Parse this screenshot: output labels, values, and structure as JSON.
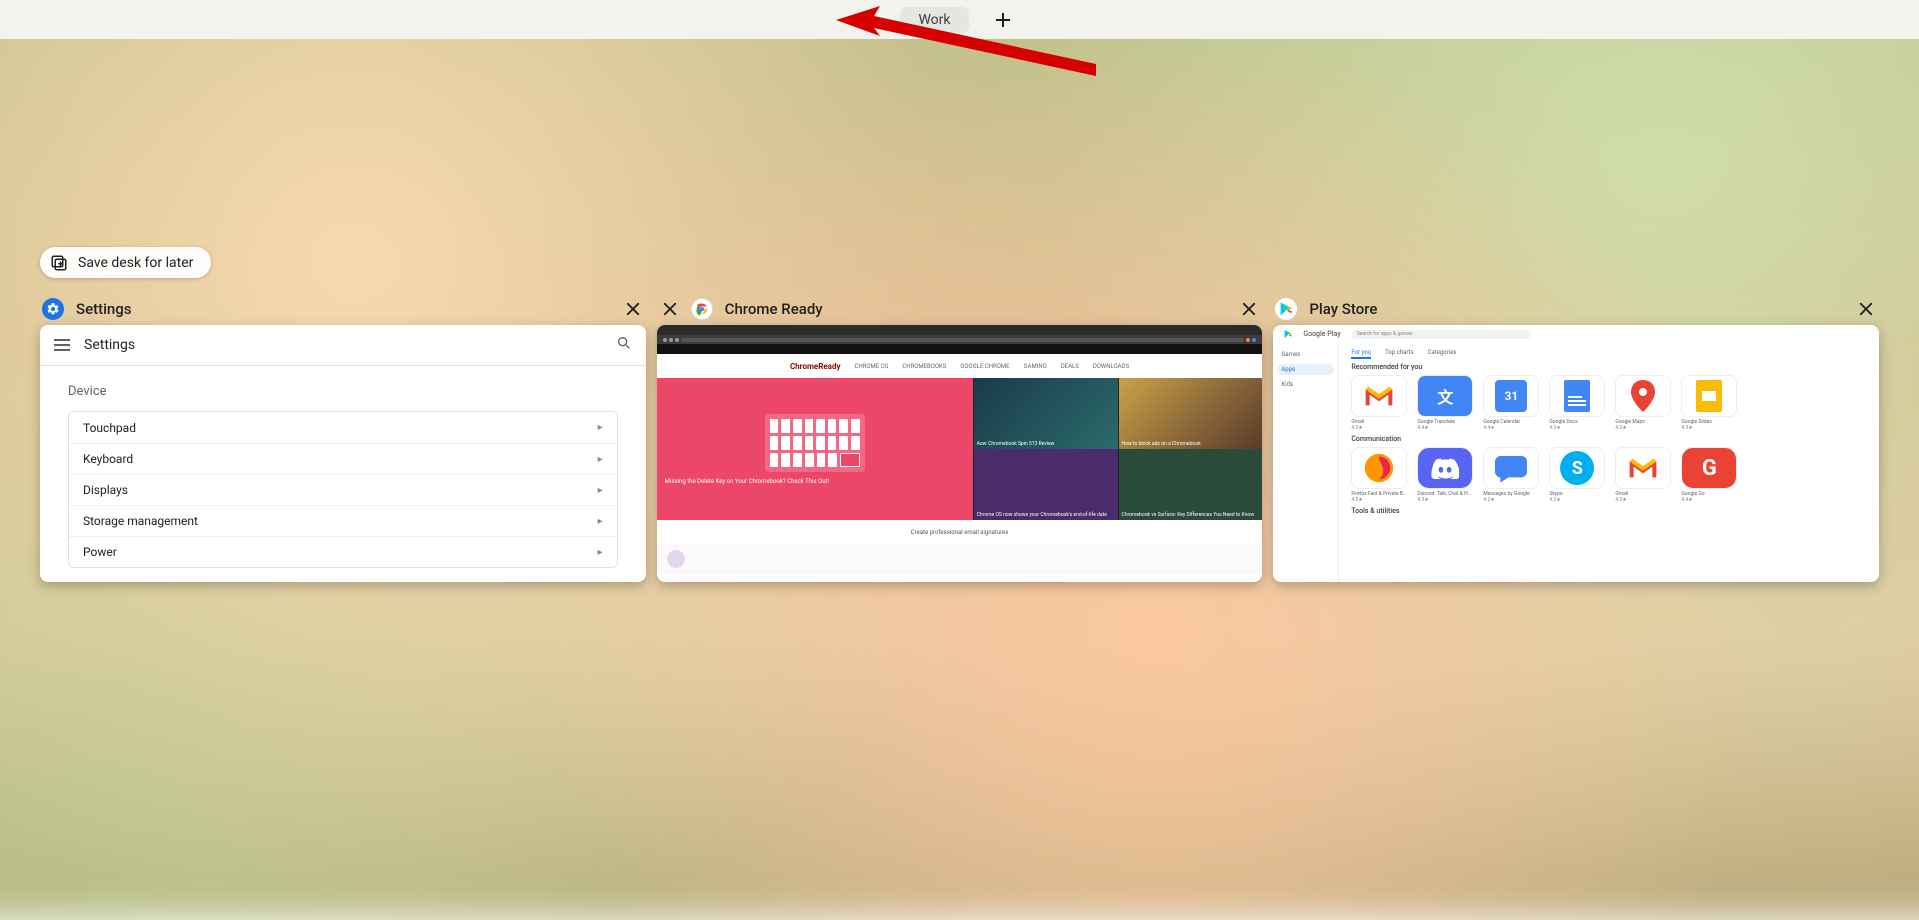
{
  "desk_bar": {
    "active_desk": "Work"
  },
  "save_pill": "Save desk for later",
  "windows": [
    {
      "title": "Settings",
      "close": "✕",
      "content": {
        "header_title": "Settings",
        "section": "Device",
        "rows": [
          "Touchpad",
          "Keyboard",
          "Displays",
          "Storage management",
          "Power"
        ]
      }
    },
    {
      "title": "Chrome Ready",
      "close": "✕",
      "content": {
        "logo": "ChromeReady",
        "nav": [
          "CHROME OS",
          "CHROMEBOOKS",
          "GOOGLE CHROME",
          "GAMING",
          "DEALS",
          "DOWNLOADS"
        ],
        "hero_caption": "Missing the Delete Key on Your Chromebook? Check This Out!",
        "side_cards": [
          "Acer Chromebook Spin 513 Review",
          "How to block ads on a Chromebook",
          "Chrome OS now shows your Chromebook's end-of-life date",
          "Chromebook vs Surface: Key Differences You Need to Know"
        ],
        "ad": "Create professional email signatures"
      }
    },
    {
      "title": "Play Store",
      "close": "✕",
      "content": {
        "brand": "Google Play",
        "search_placeholder": "Search for apps & games",
        "sidebar": [
          "Games",
          "Apps",
          "Kids"
        ],
        "tabs": [
          "For you",
          "Top charts",
          "Categories"
        ],
        "section1": "Recommended for you",
        "row1": [
          {
            "name": "Gmail",
            "rating": "4.3★"
          },
          {
            "name": "Google Translate",
            "rating": "4.4★"
          },
          {
            "name": "Google Calendar",
            "rating": "4.4★"
          },
          {
            "name": "Google Docs",
            "rating": "4.3★"
          },
          {
            "name": "Google Maps",
            "rating": "4.2★"
          },
          {
            "name": "Google Slides",
            "rating": "4.3★"
          }
        ],
        "section2": "Communication",
        "row2": [
          {
            "name": "Firefox Fast & Private Browser",
            "rating": "4.5★"
          },
          {
            "name": "Discord: Talk, Chat & Hang Out",
            "rating": "4.3★"
          },
          {
            "name": "Messages by Google",
            "rating": "4.2★"
          },
          {
            "name": "Skype",
            "rating": "4.2★"
          },
          {
            "name": "Gmail",
            "rating": "4.3★"
          },
          {
            "name": "Google Go",
            "rating": "4.4★"
          }
        ],
        "section3": "Tools & utilities"
      }
    }
  ]
}
